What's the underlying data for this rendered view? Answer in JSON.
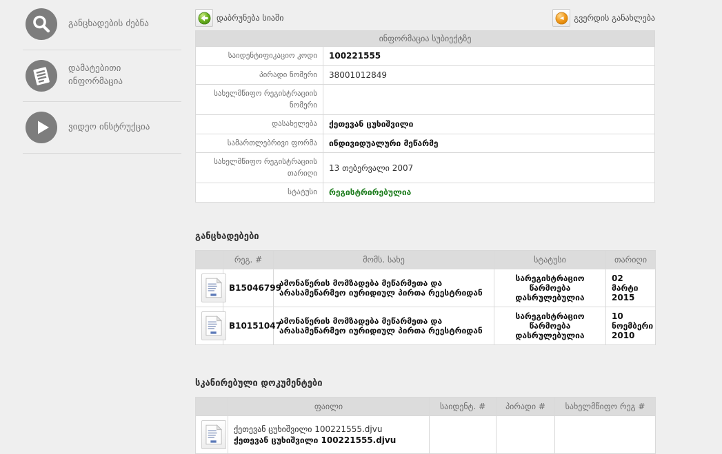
{
  "colors": {
    "status_green": "#1e7d1e",
    "header_bar": "#dcdcdc",
    "page_background": "#efefef",
    "back_icon_green": "#5ba515",
    "refresh_icon_orange": "#f29c1f"
  },
  "sidebar": {
    "items": [
      {
        "icon": "search-icon",
        "label": "განცხადების ძებნა"
      },
      {
        "icon": "document-icon",
        "label": "დამატებითი ინფორმაცია"
      },
      {
        "icon": "play-icon",
        "label": "ვიდეო ინსტრუქცია"
      }
    ]
  },
  "toolbar": {
    "back_label": "დაბრუნება სიაში",
    "refresh_label": "გვერდის განახლება"
  },
  "subject": {
    "title": "ინფორმაცია სუბიექტზე",
    "rows": [
      {
        "label": "საიდენტიფიკაციო კოდი",
        "value": "100221555"
      },
      {
        "label": "პირადი ნომერი",
        "value": "38001012849"
      },
      {
        "label": "სახელმწიფო რეგისტრაციის ნომერი",
        "value": ""
      },
      {
        "label": "დასახელება",
        "value": "ქეთევან ცუხიშვილი"
      },
      {
        "label": "სამართლებრივი ფორმა",
        "value": "ინდივიდუალური მეწარმე"
      },
      {
        "label": "სახელმწიფო რეგისტრაციის თარიღი",
        "value": "13 თებერვალი 2007"
      },
      {
        "label": "სტატუსი",
        "value": "რეგისტრირებულია"
      }
    ]
  },
  "applications": {
    "title": "განცხადებები",
    "headers": {
      "reg": "რეგ. #",
      "service": "მომს. სახე",
      "status": "სტატუსი",
      "date": "თარიღი"
    },
    "rows": [
      {
        "reg": "B15046799",
        "service": "ამონაწერის მომზადება მეწარმეთა და არასამეწარმეო იურიდიულ პირთა რეესტრიდან",
        "status": "სარეგისტრაციო წარმოება დასრულებულია",
        "date": "02 მარტი 2015"
      },
      {
        "reg": "B10151047",
        "service": "ამონაწერის მომზადება მეწარმეთა და არასამეწარმეო იურიდიულ პირთა რეესტრიდან",
        "status": "სარეგისტრაციო წარმოება დასრულებულია",
        "date": "10 ნოემბერი 2010"
      }
    ]
  },
  "documents": {
    "title": "სკანირებული დოკუმენტები",
    "headers": {
      "file": "ფაილი",
      "ident": "საიდენტ. #",
      "personal": "პირადი #",
      "state_reg": "სახელმწიფო რეგ #"
    },
    "rows": [
      {
        "file_link": "ქეთევან ცუხიშვილი 100221555.djvu",
        "file_name": "ქეთევან ცუხიშვილი 100221555.djvu",
        "ident": "",
        "personal": "",
        "state_reg": ""
      }
    ]
  }
}
